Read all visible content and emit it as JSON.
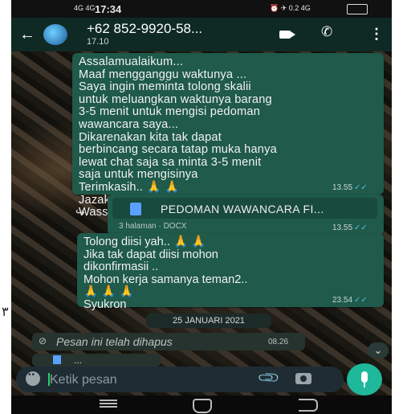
{
  "status_bar": {
    "signal": "4G 4G",
    "time": "17:34",
    "right_icons": "⏰ ✈ 0.2 4G",
    "battery": ""
  },
  "app_bar": {
    "back": "←",
    "contact_name": "+62 852-9920-58...",
    "subtitle": "17.10",
    "call_icon": "✆",
    "more_icon": "⋮"
  },
  "messages": [
    {
      "text": "Assalamualaikum...\nMaaf mengganggu waktunya ...\nSaya ingin meminta tolong skalii\nuntuk meluangkan waktunya barang\n3-5 menit untuk mengisi pedoman\nwawancara saya...\nDikarenakan kita tak dapat\nberbincang secara tatap muka hanya\nlewat chat saja sa minta 3-5 menit\nsaja untuk mengisinya\nTerimkasih.. 🙏 🙏\nJazakallah khair/jazakillah khair...\nWassalam",
      "time": "13.55",
      "ticks": "✓✓"
    },
    {
      "file_name": "PEDOMAN WAWANCARA FI...",
      "meta": "3 halaman · DOCX",
      "time": "13.55",
      "ticks": "✓✓"
    },
    {
      "text": "Tolong diisi yah.. 🙏 🙏\nJika tak dapat diisi mohon\ndikonfirmasii ..\nMohon kerja samanya teman2..\n🙏 🙏 🙏\nSyukron",
      "time": "23.54",
      "ticks": "✓✓"
    }
  ],
  "date_chip": "25 JANUARI 2021",
  "deleted_message": {
    "icon": "⊘",
    "text": "Pesan ini telah dihapus",
    "time": "08.26"
  },
  "partial_message": {
    "text": "..."
  },
  "input": {
    "placeholder": "Ketik pesan",
    "attach_icon": "📎"
  },
  "scroll_down": "⌄",
  "forward_icon": "↪",
  "margin_mark": "٣",
  "colors": {
    "bubble": "#1f5a4a",
    "appbar": "#0f2a24",
    "mic": "#1fb89a",
    "ticks": "#53bdeb"
  }
}
